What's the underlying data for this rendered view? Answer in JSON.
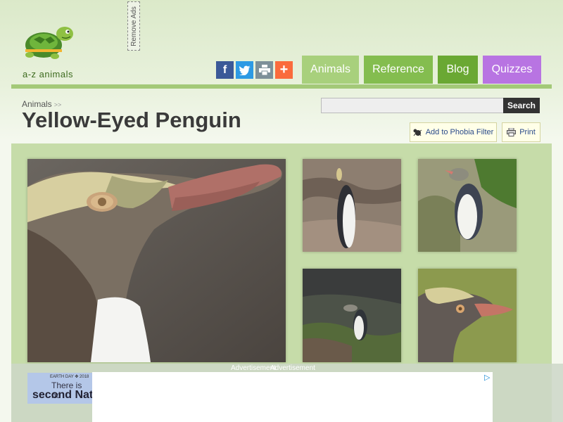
{
  "brand": {
    "name": "a-z animals"
  },
  "ads": {
    "remove_label": "Remove Ads",
    "label_1": "Advertisement",
    "label_2": "Advertisement",
    "banner_line1": "EARTH DAY ✤ 2018",
    "banner_line2": "There is no",
    "banner_line3": "second Nat"
  },
  "social": [
    {
      "label": "f",
      "icon": "facebook-icon",
      "color": "#3b5998"
    },
    {
      "label": "t",
      "icon": "twitter-icon",
      "color": "#2d9ae4"
    },
    {
      "label": "p",
      "icon": "print-icon",
      "color": "#7d9099"
    },
    {
      "label": "+",
      "icon": "plus-icon",
      "color": "#fa6b3c"
    }
  ],
  "nav": {
    "animals": "Animals",
    "reference": "Reference",
    "blog": "Blog",
    "quizzes": "Quizzes"
  },
  "colors": {
    "nav_animals": "#a8d07c",
    "nav_reference": "#84bd4f",
    "nav_blog": "#6aa833",
    "nav_quizzes": "#b874e2"
  },
  "breadcrumb": {
    "item": "Animals",
    "separator": ">>"
  },
  "page": {
    "title": "Yellow-Eyed Penguin"
  },
  "search": {
    "placeholder": "",
    "button": "Search"
  },
  "tools": {
    "phobia": "Add to Phobia Filter",
    "print": "Print"
  }
}
